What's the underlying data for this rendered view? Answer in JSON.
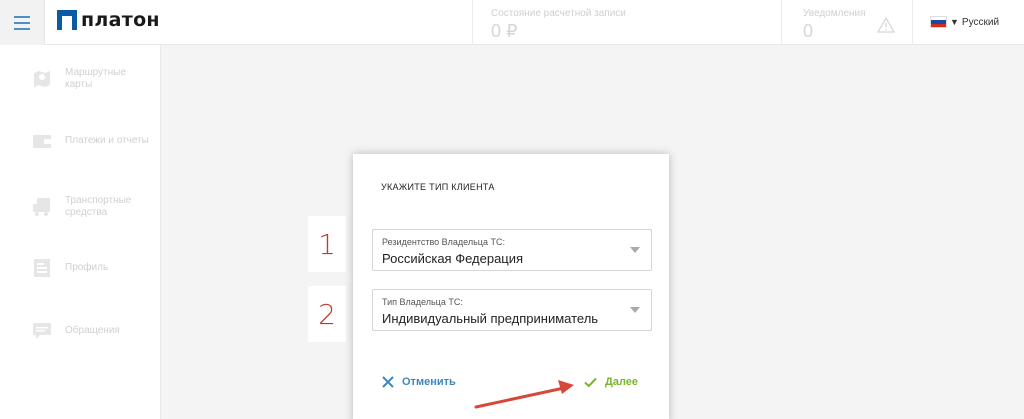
{
  "header": {
    "logo_text": "платон",
    "account": {
      "label": "Состояние расчетной записи",
      "value": "0 ₽"
    },
    "notifications": {
      "label": "Уведомления",
      "value": "0"
    },
    "language": "Русский"
  },
  "sidebar": {
    "items": [
      {
        "label": "Маршрутные\nкарты",
        "icon": "map-pin-icon"
      },
      {
        "label": "Платежи и отчеты",
        "icon": "wallet-icon"
      },
      {
        "label": "Транспортные\nсредства",
        "icon": "truck-icon"
      },
      {
        "label": "Профиль",
        "icon": "profile-icon"
      },
      {
        "label": "Обращения",
        "icon": "message-icon"
      }
    ]
  },
  "dialog": {
    "title": "УКАЖИТЕ ТИП КЛИЕНТА",
    "residence": {
      "label": "Резидентство Владельца ТС:",
      "value": "Российская Федерация"
    },
    "owner_type": {
      "label": "Тип Владельца ТС:",
      "value": "Индивидуальный предприниматель"
    },
    "cancel_label": "Отменить",
    "next_label": "Далее"
  },
  "steps": [
    "1",
    "2"
  ],
  "colors": {
    "accent_blue": "#3d86c4",
    "accent_green": "#7ab52a",
    "step_red": "#c0392b",
    "logo_blue": "#0a5ba3"
  }
}
